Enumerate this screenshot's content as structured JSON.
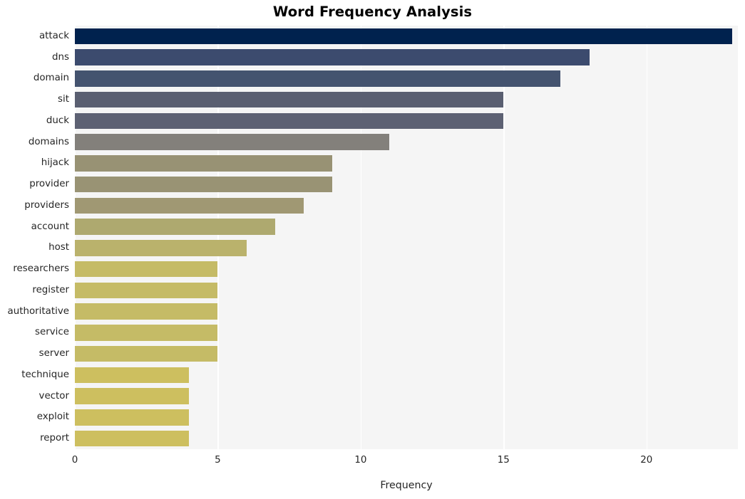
{
  "chart_data": {
    "type": "bar",
    "orientation": "horizontal",
    "title": "Word Frequency Analysis",
    "xlabel": "Frequency",
    "ylabel": "",
    "categories": [
      "attack",
      "dns",
      "domain",
      "sit",
      "duck",
      "domains",
      "hijack",
      "provider",
      "providers",
      "account",
      "host",
      "researchers",
      "register",
      "authoritative",
      "service",
      "server",
      "technique",
      "vector",
      "exploit",
      "report"
    ],
    "values": [
      23,
      18,
      17,
      15,
      15,
      11,
      9,
      9,
      8,
      7,
      6,
      5,
      5,
      5,
      5,
      5,
      4,
      4,
      4,
      4
    ],
    "bar_colors": [
      "#00224e",
      "#3c4b6e",
      "#44536f",
      "#5a5f71",
      "#5d6173",
      "#83807b",
      "#989274",
      "#999374",
      "#a09873",
      "#aea96f",
      "#bab26c",
      "#c5bb66",
      "#c5bb66",
      "#c5bb66",
      "#c5bb66",
      "#c5bb66",
      "#cdbf5f",
      "#cdbf5f",
      "#cdbf5f",
      "#cdbf5f"
    ],
    "xlim": [
      0,
      23.2
    ],
    "xticks": [
      0,
      5,
      10,
      15,
      20
    ],
    "xtick_labels": [
      "0",
      "5",
      "10",
      "15",
      "20"
    ],
    "grid": "vertical-white",
    "plot_background": "#f5f5f5",
    "figure_background": "#ffffff",
    "legend": null,
    "colormap": "cividis"
  }
}
